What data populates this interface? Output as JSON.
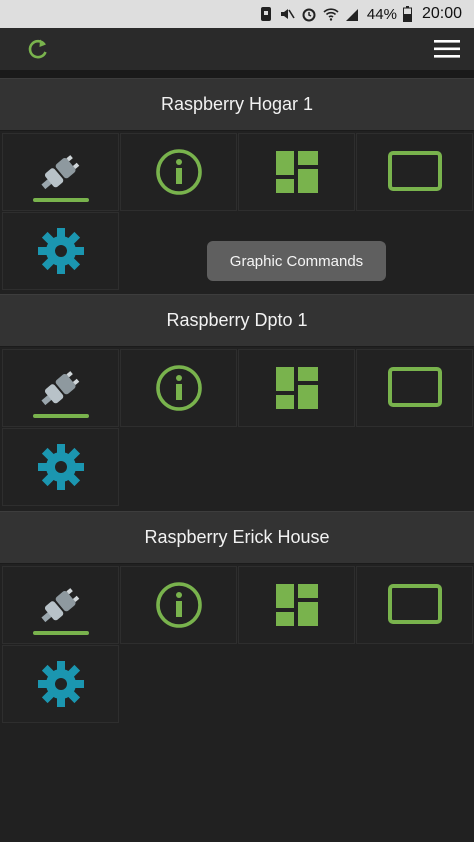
{
  "status_bar": {
    "battery_percent": "44%",
    "time": "20:00",
    "icons": [
      "notification-icon",
      "mute-icon",
      "alarm-icon",
      "wifi-icon",
      "signal-icon",
      "battery-icon"
    ]
  },
  "app_bar": {
    "refresh_icon": "refresh-icon",
    "menu_icon": "hamburger-menu-icon"
  },
  "colors": {
    "accent_green": "#79b34d",
    "gear_teal": "#1b96b0",
    "tooltip_bg": "#5f5f5f"
  },
  "devices": [
    {
      "name": "Raspberry Hogar 1",
      "actions": [
        "connect-plug-icon",
        "info-icon",
        "dashboard-icon",
        "screen-icon",
        "settings-gear-icon"
      ]
    },
    {
      "name": "Raspberry Dpto 1",
      "actions": [
        "connect-plug-icon",
        "info-icon",
        "dashboard-icon",
        "screen-icon",
        "settings-gear-icon"
      ]
    },
    {
      "name": "Raspberry Erick House",
      "actions": [
        "connect-plug-icon",
        "info-icon",
        "dashboard-icon",
        "screen-icon",
        "settings-gear-icon"
      ]
    }
  ],
  "tooltip": {
    "text": "Graphic Commands"
  }
}
